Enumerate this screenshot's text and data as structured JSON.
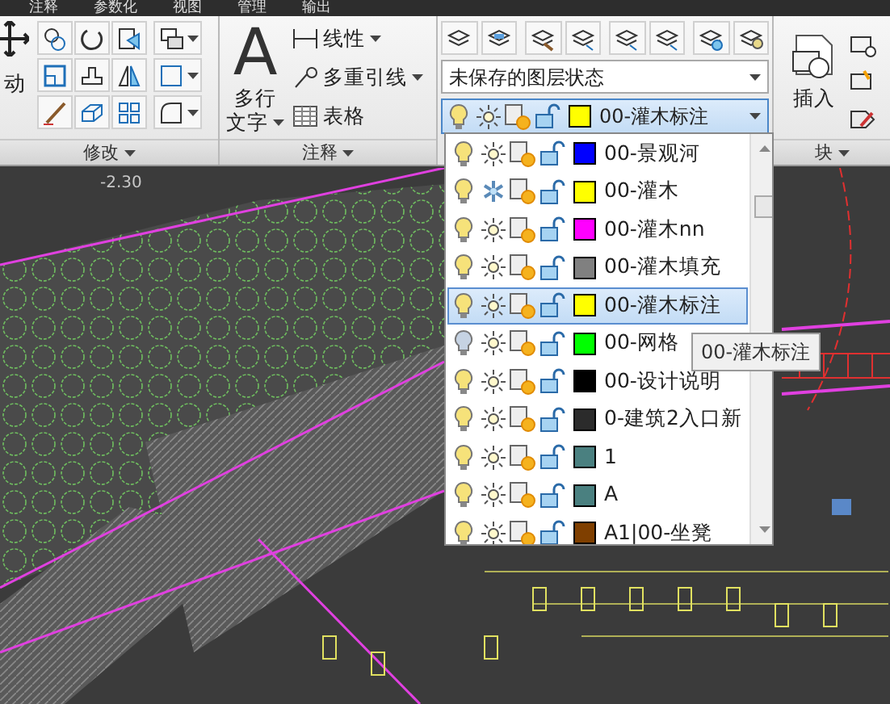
{
  "menu_tabs": [
    "注释",
    "参数化",
    "视图",
    "管理",
    "输出"
  ],
  "modify_panel": {
    "title": "修改",
    "move_label": "动"
  },
  "annotation_panel": {
    "title": "注释",
    "mtext_icon": "A",
    "mtext_label": [
      "多行",
      "文字"
    ],
    "tools": [
      {
        "kind": "dimension",
        "label": "线性",
        "dropdown": true
      },
      {
        "kind": "leader",
        "label": "多重引线",
        "dropdown": true
      },
      {
        "kind": "table",
        "label": "表格",
        "dropdown": false
      }
    ]
  },
  "layers_panel": {
    "layer_state": "未保存的图层状态",
    "current_layer": {
      "name": "00-灌木标注",
      "color": "#ffff00"
    }
  },
  "layer_list": [
    {
      "name": "00-景观河",
      "color": "#0000ff",
      "on": true,
      "frozen": false,
      "selected": false
    },
    {
      "name": "00-灌木",
      "color": "#ffff00",
      "on": true,
      "frozen": true,
      "selected": false
    },
    {
      "name": "00-灌木nn",
      "color": "#ff00ff",
      "on": true,
      "frozen": false,
      "selected": false
    },
    {
      "name": "00-灌木填充",
      "color": "#808080",
      "on": true,
      "frozen": false,
      "selected": false
    },
    {
      "name": "00-灌木标注",
      "color": "#ffff00",
      "on": true,
      "frozen": false,
      "selected": true
    },
    {
      "name": "00-网格",
      "color": "#00ff00",
      "on": false,
      "frozen": false,
      "selected": false
    },
    {
      "name": "00-设计说明",
      "color": "#000000",
      "on": true,
      "frozen": false,
      "selected": false
    },
    {
      "name": "0-建筑2入口新",
      "color": "#2b2b2b",
      "on": true,
      "frozen": false,
      "selected": false
    },
    {
      "name": "1",
      "color": "#4a8080",
      "on": true,
      "frozen": false,
      "selected": false
    },
    {
      "name": "A",
      "color": "#4a8080",
      "on": true,
      "frozen": false,
      "selected": false
    },
    {
      "name": "A1|00-坐凳",
      "color": "#7f3f00",
      "on": true,
      "frozen": false,
      "selected": false
    }
  ],
  "tooltip": "00-灌木标注",
  "block_panel": {
    "title": "块",
    "insert_label": "插入"
  },
  "drawing": {
    "label": "-2.30"
  }
}
